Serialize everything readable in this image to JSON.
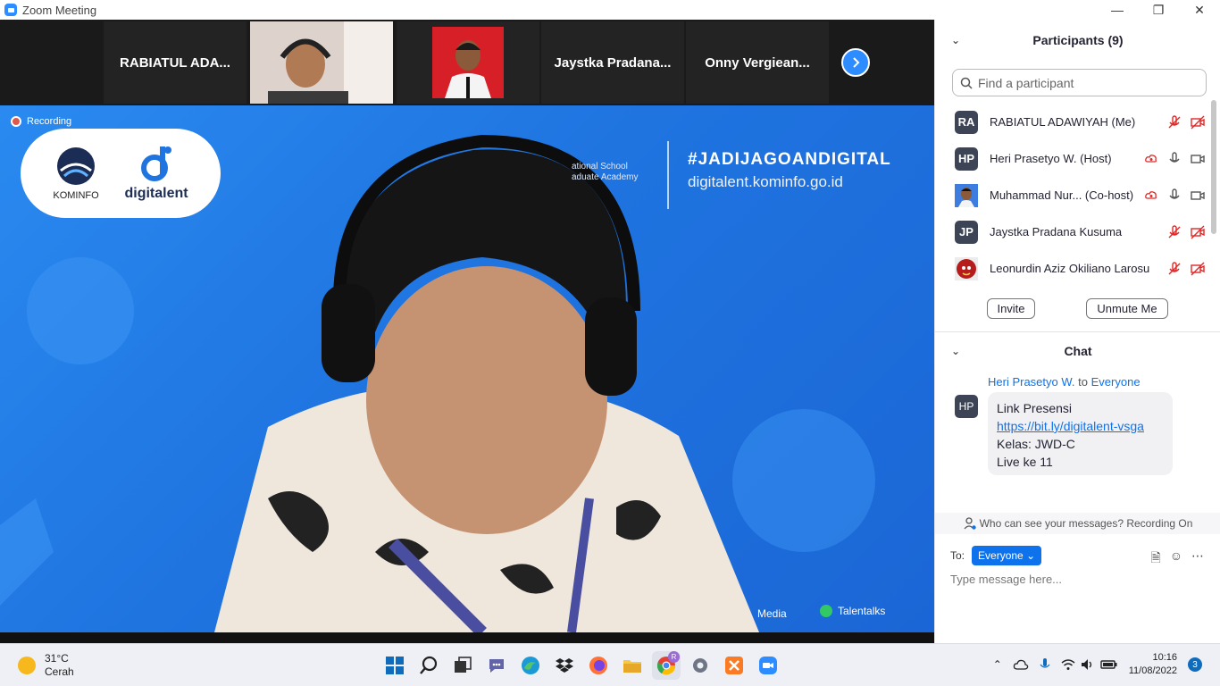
{
  "window": {
    "title": "Zoom Meeting",
    "controls": [
      "—",
      "❐",
      "✕"
    ]
  },
  "strip": {
    "tiles": [
      {
        "name": "RABIATUL ADA..."
      },
      {
        "name": ""
      },
      {
        "name": ""
      },
      {
        "name": "Jaystka  Pradana..."
      },
      {
        "name": "Onny  Vergiean..."
      }
    ]
  },
  "video": {
    "recording_label": "Recording",
    "logo1": "KOMINFO",
    "logo2": "digitalent",
    "hashtag": "#JADIJAGOANDIGITAL",
    "site": "digitalent.kominfo.go.id",
    "school_line1": "ational School",
    "school_line2": "aduate Academy",
    "footer_media": "Media",
    "footer_talentalks": "Talentalks"
  },
  "participants": {
    "header": "Participants (9)",
    "search_placeholder": "Find a participant",
    "list": [
      {
        "initials": "RA",
        "name": "RABIATUL ADAWIYAH (Me)",
        "avatar": "initials"
      },
      {
        "initials": "HP",
        "name": "Heri Prasetyo W. (Host)",
        "avatar": "initials"
      },
      {
        "initials": "",
        "name": "Muhammad Nur...  (Co-host)",
        "avatar": "photo"
      },
      {
        "initials": "JP",
        "name": "Jaystka Pradana Kusuma",
        "avatar": "initials"
      },
      {
        "initials": "",
        "name": "Leonurdin Aziz Okiliano Larosu",
        "avatar": "photo2"
      }
    ],
    "invite_label": "Invite",
    "unmute_label": "Unmute Me"
  },
  "chat": {
    "header": "Chat",
    "sender": "Heri Prasetyo W.",
    "to_word": "to",
    "recipient": "Everyone",
    "sender_initials": "HP",
    "message_line1": "Link Presensi",
    "message_link": "https://bit.ly/digitalent-vsga",
    "message_line3": "Kelas: JWD-C",
    "message_line4": "Live ke 11",
    "visibility_note": "Who can see your messages? Recording On",
    "to_label": "To:",
    "to_value": "Everyone",
    "input_placeholder": "Type message here..."
  },
  "taskbar": {
    "temperature": "31°C",
    "weather": "Cerah",
    "time": "10:16",
    "date": "11/08/2022",
    "notification_count": "3",
    "chrome_profile": "R"
  }
}
